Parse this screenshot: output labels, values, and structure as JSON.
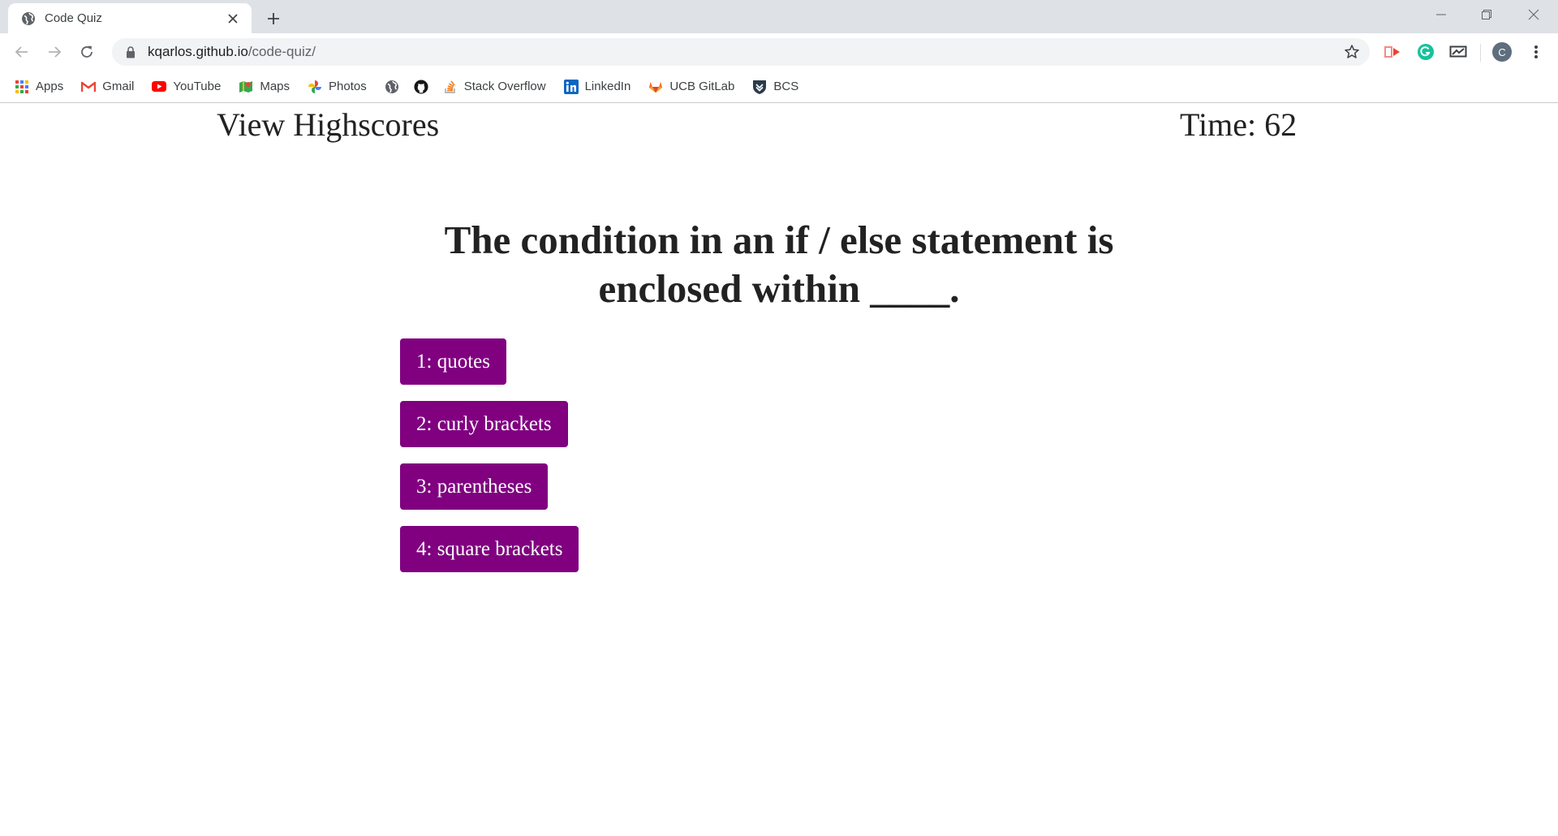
{
  "browser": {
    "tab": {
      "title": "Code Quiz",
      "favicon": "globe-icon"
    },
    "url": {
      "host": "kqarlos.github.io",
      "path": "/code-quiz/"
    },
    "profile_initial": "C",
    "bookmarks": [
      {
        "label": "Apps",
        "icon": "apps-grid-icon"
      },
      {
        "label": "Gmail",
        "icon": "gmail-icon"
      },
      {
        "label": "YouTube",
        "icon": "youtube-icon"
      },
      {
        "label": "Maps",
        "icon": "maps-icon"
      },
      {
        "label": "Photos",
        "icon": "photos-icon"
      },
      {
        "label": "",
        "icon": "globe-icon"
      },
      {
        "label": "",
        "icon": "github-icon"
      },
      {
        "label": "Stack Overflow",
        "icon": "stackoverflow-icon"
      },
      {
        "label": "LinkedIn",
        "icon": "linkedin-icon"
      },
      {
        "label": "UCB GitLab",
        "icon": "gitlab-icon"
      },
      {
        "label": "BCS",
        "icon": "bcs-shield-icon"
      }
    ]
  },
  "quiz": {
    "highscores_link": "View Highscores",
    "timer": "Time: 62",
    "question": "The condition in an if / else statement is enclosed within ____.",
    "answers": [
      "1: quotes",
      "2: curly brackets",
      "3: parentheses",
      "4: square brackets"
    ],
    "button_color": "#800080"
  }
}
